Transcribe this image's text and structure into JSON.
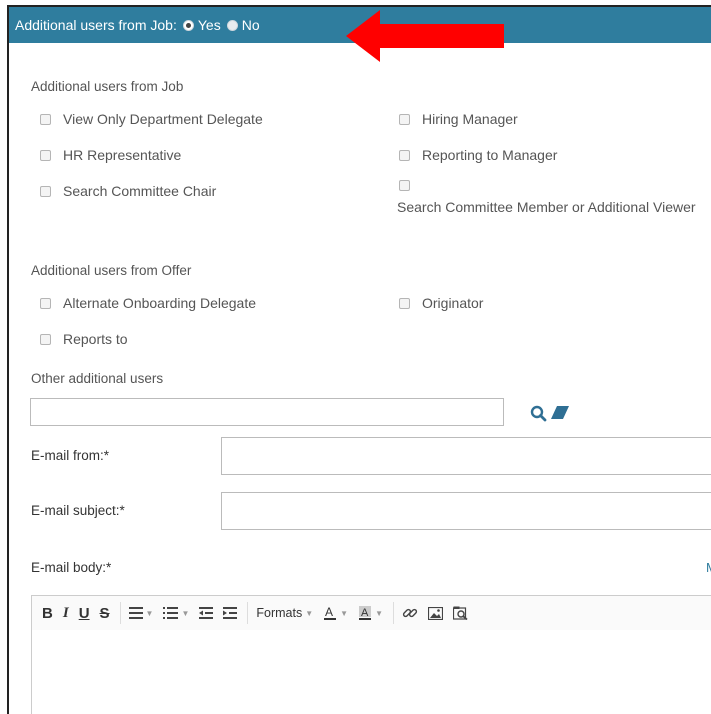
{
  "header": {
    "label": "Additional users from Job:",
    "options": [
      {
        "label": "Yes",
        "checked": true
      },
      {
        "label": "No",
        "checked": false
      }
    ],
    "background": "#2f7d9e"
  },
  "annotation_arrow_color": "#ff0000",
  "job_section": {
    "title": "Additional users from Job",
    "items": [
      "View Only Department Delegate",
      "Hiring Manager",
      "HR Representative",
      "Reporting to Manager",
      "Search Committee Chair",
      "Search Committee Member or Additional Viewer"
    ]
  },
  "offer_section": {
    "title": "Additional users from Offer",
    "items": [
      "Alternate Onboarding Delegate",
      "Originator",
      "Reports to"
    ]
  },
  "other_users": {
    "label": "Other additional users",
    "value": ""
  },
  "email": {
    "from_label": "E-mail from:*",
    "from_value": "",
    "subject_label": "E-mail subject:*",
    "subject_value": "",
    "body_label": "E-mail body:*",
    "more_link": "M"
  },
  "toolbar": {
    "bold": "B",
    "italic": "I",
    "underline": "U",
    "strike": "S",
    "formats": "Formats"
  }
}
